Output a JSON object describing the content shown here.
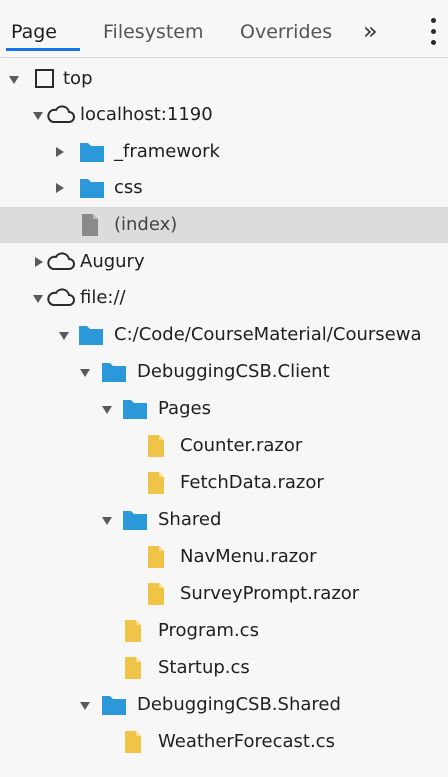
{
  "tabs": {
    "page": "Page",
    "filesystem": "Filesystem",
    "overrides": "Overrides",
    "more": "»"
  },
  "colors": {
    "accent": "#1a73e8",
    "folder": "#2a98d9",
    "file_yellow": "#f0c447",
    "file_gray": "#8a8a8a",
    "selected_row": "#dcdcdc"
  },
  "tree": {
    "top": "top",
    "localhost": "localhost:1190",
    "framework": "_framework",
    "css": "css",
    "index": "(index)",
    "augury": "Augury",
    "file": "file://",
    "coursework_path": "C:/Code/CourseMaterial/Coursewa",
    "client": "DebuggingCSB.Client",
    "pages": "Pages",
    "counter": "Counter.razor",
    "fetchdata": "FetchData.razor",
    "shared": "Shared",
    "navmenu": "NavMenu.razor",
    "surveyprompt": "SurveyPrompt.razor",
    "program": "Program.cs",
    "startup": "Startup.cs",
    "shared_project": "DebuggingCSB.Shared",
    "weatherforecast": "WeatherForecast.cs"
  }
}
